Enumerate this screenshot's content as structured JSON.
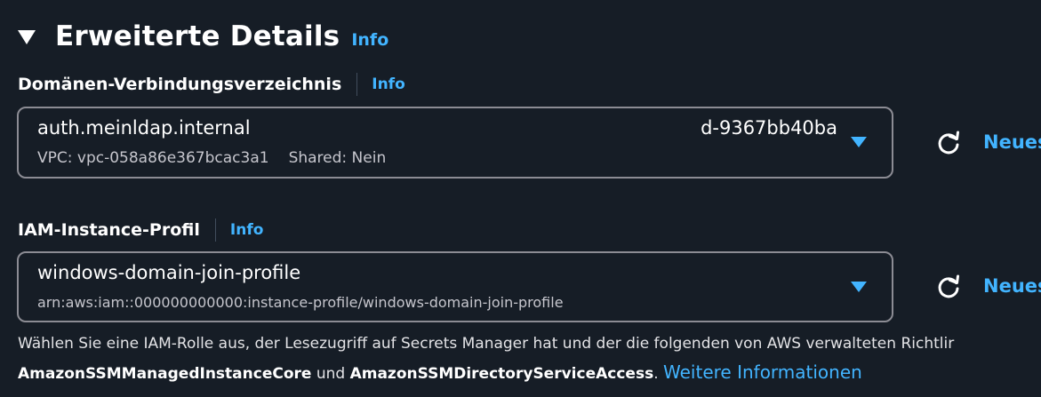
{
  "section": {
    "title": "Erweiterte Details",
    "info_label": "Info"
  },
  "directory_field": {
    "label": "Domänen-Verbindungsverzeichnis",
    "info_label": "Info",
    "selected_name": "auth.meinldap.internal",
    "selected_id": "d-9367bb40ba",
    "vpc_text": "VPC: vpc-058a86e367bcac3a1",
    "shared_text": "Shared: Nein",
    "new_link": "Neues"
  },
  "iam_field": {
    "label": "IAM-Instance-Profil",
    "info_label": "Info",
    "selected_name": "windows-domain-join-profile",
    "selected_arn": "arn:aws:iam::000000000000:instance-profile/windows-domain-join-profile",
    "new_link": "Neues"
  },
  "help": {
    "line1": "Wählen Sie eine IAM-Rolle aus, der Lesezugriff auf Secrets Manager hat und der die folgenden von AWS verwalteten Richtlir",
    "policy1": "AmazonSSMManagedInstanceCore",
    "and_text": " und ",
    "policy2": "AmazonSSMDirectoryServiceAccess",
    "period": ". ",
    "more_link": "Weitere Informationen"
  },
  "icons": {
    "caret": "caret-down-icon",
    "refresh": "refresh-icon",
    "dropdown": "dropdown-arrow-icon"
  },
  "colors": {
    "background": "#161d26",
    "link": "#42b4ff",
    "border": "#8c8c94",
    "text": "#ffffff",
    "secondary_text": "#c6c6cd"
  }
}
